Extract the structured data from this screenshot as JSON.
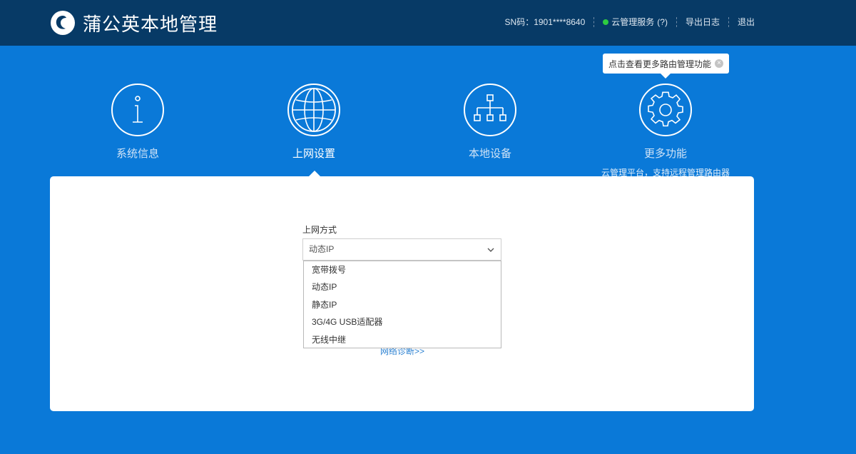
{
  "header": {
    "title": "蒲公英本地管理",
    "sn_label": "SN码：",
    "sn_value": "1901****8640",
    "cloud_service": "云管理服务",
    "cloud_help": "(?)",
    "export_log": "导出日志",
    "logout": "退出",
    "cloud_status_color": "#2ecc40"
  },
  "tooltip": {
    "text": "点击查看更多路由管理功能",
    "close_icon": "close-icon"
  },
  "nav": {
    "items": [
      {
        "label": "系统信息",
        "icon": "info-icon"
      },
      {
        "label": "上网设置",
        "icon": "globe-icon",
        "active": true
      },
      {
        "label": "本地设备",
        "icon": "network-icon"
      },
      {
        "label": "更多功能",
        "icon": "gear-icon",
        "sub": "云管理平台，支持远程管理路由器"
      }
    ]
  },
  "form": {
    "label": "上网方式",
    "selected": "动态IP",
    "options": [
      "宽带拨号",
      "动态IP",
      "静态IP",
      "3G/4G USB适配器",
      "无线中继"
    ],
    "diagnose_link": "网络诊断>>"
  },
  "colors": {
    "header_bg": "#073a66",
    "page_bg": "#0a79d8",
    "panel_bg": "#ffffff",
    "link": "#2d82d2"
  }
}
